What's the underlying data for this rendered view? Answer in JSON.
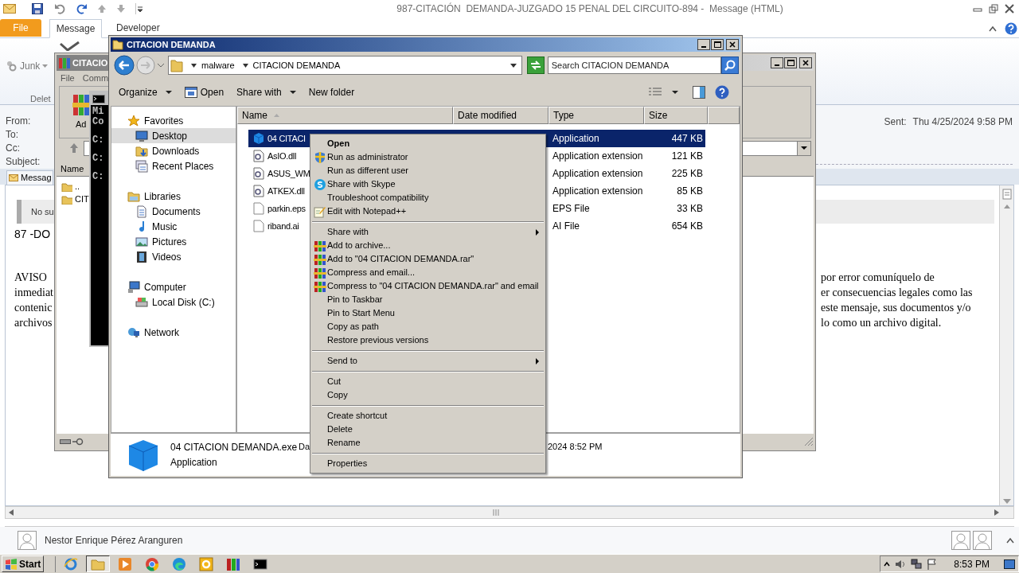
{
  "outlook": {
    "title": "987-CITACIÓN  DEMANDA-JUZGADO 15 PENAL DEL CIRCUITO-894 -  Message (HTML)",
    "ribbon_tabs": [
      {
        "label": "File",
        "kind": "file",
        "selected": false
      },
      {
        "label": "Message",
        "kind": "tab",
        "selected": true
      },
      {
        "label": "Developer",
        "kind": "tab",
        "selected": false
      }
    ],
    "junk_button": "Junk",
    "group_label": "Delet",
    "header_labels": [
      "From:",
      "To:",
      "Cc:",
      "Subject:"
    ],
    "sent_label": "Sent:",
    "sent_value": "Thu 4/25/2024 9:58 PM",
    "message_tab": "Messag",
    "info_bar": "No su",
    "body_line": "87 -DO",
    "notice_left": [
      "AVISO",
      "inmediat",
      "contenic",
      "archivos"
    ],
    "notice_right": [
      "por error comuníquelo de",
      "er consecuencias legales como las",
      "este mensaje, sus documentos y/o",
      "lo como un archivo digital."
    ],
    "people_pane": {
      "name": "Nestor Enrique Pérez Aranguren"
    }
  },
  "winrar": {
    "title": "CITACIO",
    "menu": [
      "File",
      "Comm"
    ],
    "toolbar_label": "Ad",
    "column": "Name",
    "rows": [
      "..",
      "CIT"
    ]
  },
  "console": {
    "lines": [
      "Mi",
      "Co",
      "C:",
      "C:",
      "C:"
    ]
  },
  "explorer": {
    "title": "CITACION DEMANDA",
    "breadcrumb": [
      "malware",
      "CITACION DEMANDA"
    ],
    "search_placeholder": "Search CITACION DEMANDA",
    "toolbar": [
      {
        "label": "Organize",
        "kind": "menu"
      },
      {
        "label": "Open",
        "kind": "open"
      },
      {
        "label": "Share with",
        "kind": "menu"
      },
      {
        "label": "New folder",
        "kind": "plain"
      }
    ],
    "nav": [
      {
        "label": "Favorites",
        "kind": "favorites",
        "selected": false,
        "children": [
          {
            "label": "Desktop",
            "kind": "desktop",
            "selected": true
          },
          {
            "label": "Downloads",
            "kind": "downloads",
            "selected": false
          },
          {
            "label": "Recent Places",
            "kind": "recent",
            "selected": false
          }
        ]
      },
      {
        "label": "Libraries",
        "kind": "libraries",
        "selected": false,
        "children": [
          {
            "label": "Documents",
            "kind": "documents",
            "selected": false
          },
          {
            "label": "Music",
            "kind": "music",
            "selected": false
          },
          {
            "label": "Pictures",
            "kind": "pictures",
            "selected": false
          },
          {
            "label": "Videos",
            "kind": "videos",
            "selected": false
          }
        ]
      },
      {
        "label": "Computer",
        "kind": "computer",
        "selected": false,
        "children": [
          {
            "label": "Local Disk (C:)",
            "kind": "disk",
            "selected": false
          }
        ]
      },
      {
        "label": "Network",
        "kind": "network",
        "selected": false
      }
    ],
    "columns": [
      "Name",
      "Date modified",
      "Type",
      "Size"
    ],
    "files": [
      {
        "name": "04 CITACI",
        "kind": "app",
        "type": "Application",
        "size": "447 KB",
        "selected": true
      },
      {
        "name": "AsIO.dll",
        "kind": "dll",
        "type": "Application extension",
        "size": "121 KB",
        "selected": false
      },
      {
        "name": "ASUS_WM",
        "kind": "dll",
        "type": "Application extension",
        "size": "225 KB",
        "selected": false
      },
      {
        "name": "ATKEX.dll",
        "kind": "dll",
        "type": "Application extension",
        "size": "85 KB",
        "selected": false
      },
      {
        "name": "parkin.eps",
        "kind": "blank",
        "type": "EPS File",
        "size": "33 KB",
        "selected": false
      },
      {
        "name": "riband.ai",
        "kind": "blank",
        "type": "AI File",
        "size": "654 KB",
        "selected": false
      }
    ],
    "details": {
      "name": "04 CITACION DEMANDA.exe",
      "date_label": "Da",
      "date": "2024 8:52 PM",
      "type": "Application"
    }
  },
  "context_menu": {
    "items": [
      {
        "label": "Open",
        "kind": "default"
      },
      {
        "label": "Run as administrator",
        "kind": "shield"
      },
      {
        "label": "Run as different user",
        "kind": "plain"
      },
      {
        "label": "Share with Skype",
        "kind": "skype"
      },
      {
        "label": "Troubleshoot compatibility",
        "kind": "plain"
      },
      {
        "label": "Edit with Notepad++",
        "kind": "notepad"
      },
      {
        "kind": "separator"
      },
      {
        "label": "Share with",
        "kind": "submenu"
      },
      {
        "label": "Add to archive...",
        "kind": "rar"
      },
      {
        "label": "Add to \"04 CITACION DEMANDA.rar\"",
        "kind": "rar"
      },
      {
        "label": "Compress and email...",
        "kind": "rar"
      },
      {
        "label": "Compress to \"04 CITACION DEMANDA.rar\" and email",
        "kind": "rar"
      },
      {
        "label": "Pin to Taskbar",
        "kind": "plain"
      },
      {
        "label": "Pin to Start Menu",
        "kind": "plain"
      },
      {
        "label": "Copy as path",
        "kind": "plain"
      },
      {
        "label": "Restore previous versions",
        "kind": "plain"
      },
      {
        "kind": "separator"
      },
      {
        "label": "Send to",
        "kind": "submenu"
      },
      {
        "kind": "separator"
      },
      {
        "label": "Cut",
        "kind": "plain"
      },
      {
        "label": "Copy",
        "kind": "plain"
      },
      {
        "kind": "separator"
      },
      {
        "label": "Create shortcut",
        "kind": "plain"
      },
      {
        "label": "Delete",
        "kind": "plain"
      },
      {
        "label": "Rename",
        "kind": "plain"
      },
      {
        "kind": "separator"
      },
      {
        "label": "Properties",
        "kind": "plain"
      }
    ]
  },
  "taskbar": {
    "start": "Start",
    "apps": [
      {
        "kind": "ie",
        "selected": false
      },
      {
        "kind": "explorer",
        "selected": true
      },
      {
        "kind": "media",
        "selected": false
      },
      {
        "kind": "chrome",
        "selected": false
      },
      {
        "kind": "edge",
        "selected": false
      },
      {
        "kind": "outlook",
        "selected": false
      },
      {
        "kind": "winrar",
        "selected": false
      },
      {
        "kind": "cmd",
        "selected": false
      }
    ],
    "clock": "8:53 PM"
  }
}
